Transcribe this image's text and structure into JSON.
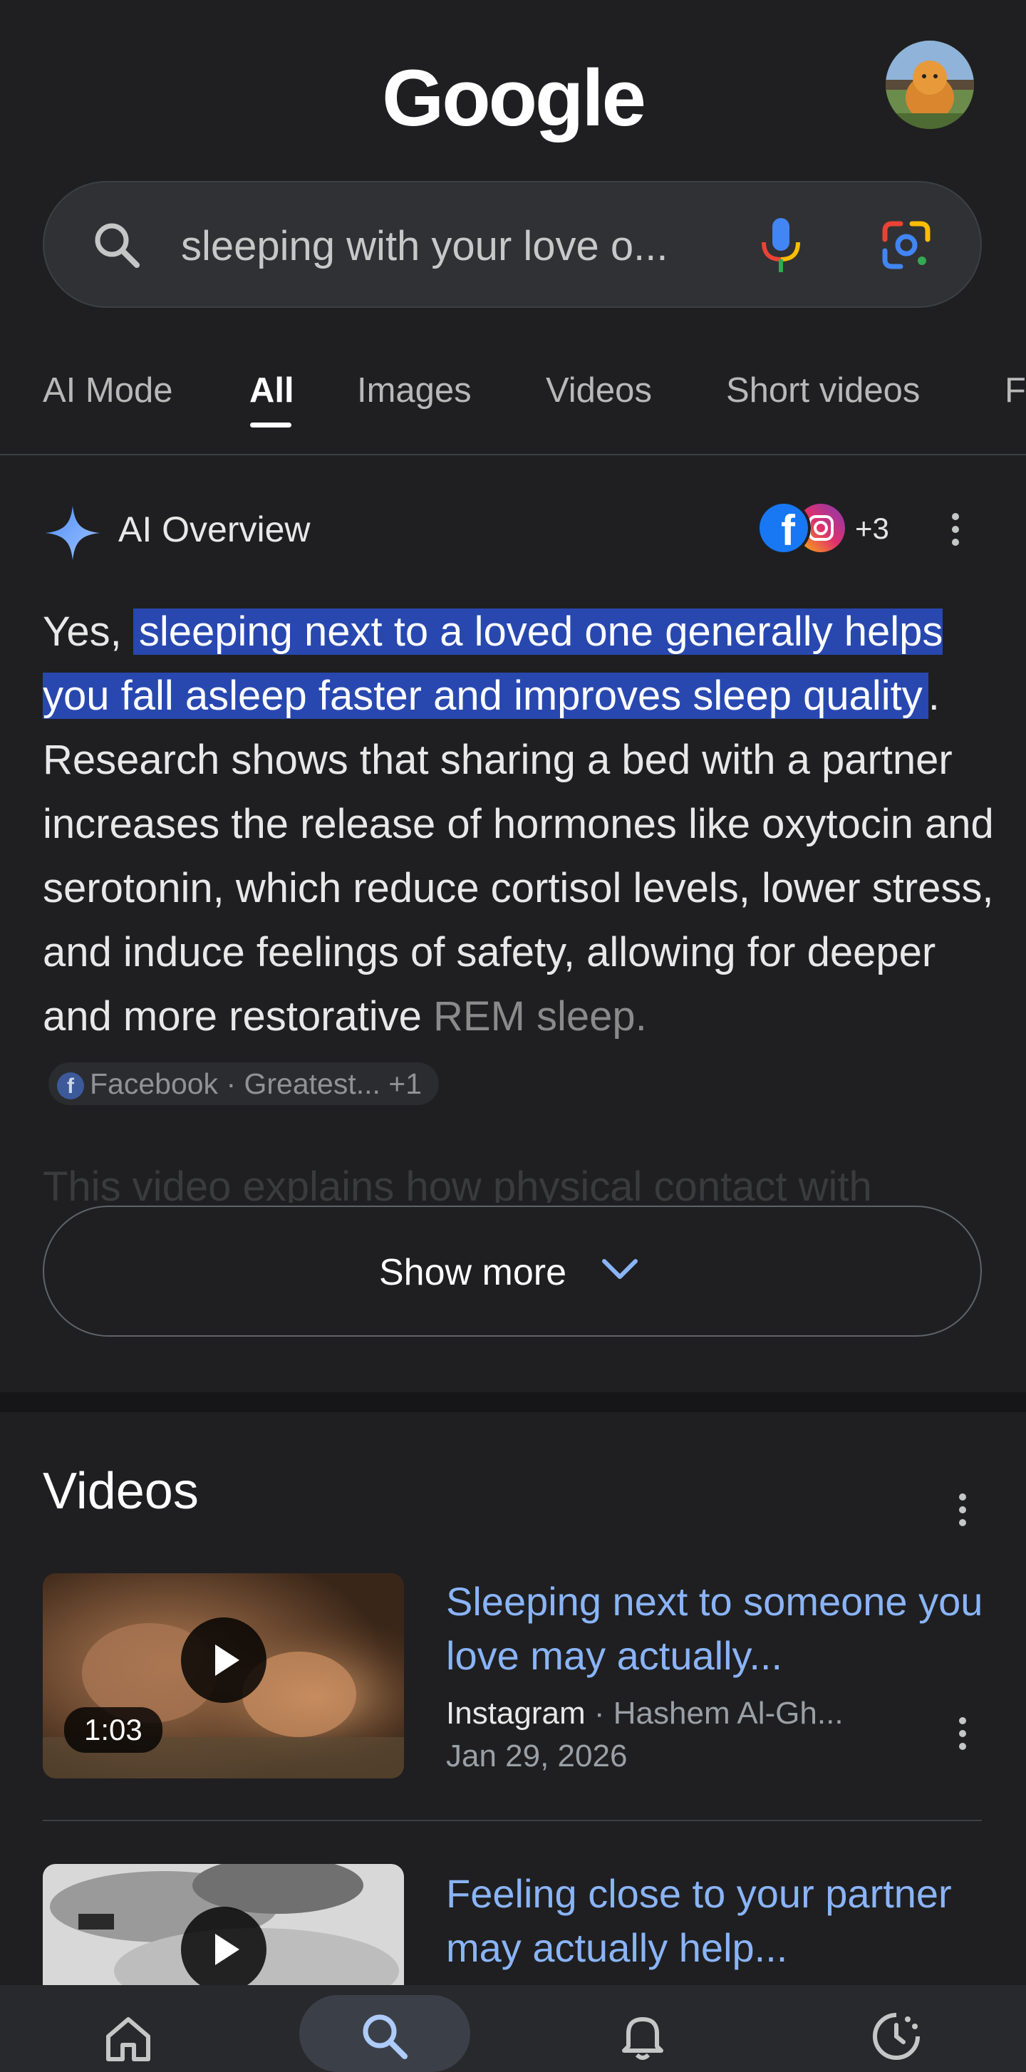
{
  "header": {
    "logo_text": "Google",
    "avatar_icon": "profile-avatar"
  },
  "search": {
    "query": "sleeping with your love o...",
    "icons": [
      "search-icon",
      "mic-icon",
      "lens-icon"
    ]
  },
  "tabs": [
    {
      "label": "AI Mode",
      "active": false
    },
    {
      "label": "All",
      "active": true
    },
    {
      "label": "Images",
      "active": false
    },
    {
      "label": "Videos",
      "active": false
    },
    {
      "label": "Short videos",
      "active": false
    },
    {
      "label": "F",
      "active": false
    }
  ],
  "ai_overview": {
    "title": "AI Overview",
    "source_count": "+3",
    "text_intro": "Yes, ",
    "text_highlight": "sleeping next to a loved one generally helps you fall asleep faster and improves sleep quality",
    "text_body": ". Research shows that sharing a bed with a partner increases the release of hormones like oxytocin and serotonin, which reduce cortisol levels, lower stress, and induce feelings of safety, allowing for deeper and more restorative ",
    "text_fade": "REM sleep.",
    "citation_chip": "Facebook · Greatest... +1",
    "truncated_line": "This video explains how physical contact with",
    "show_more_label": "Show more"
  },
  "videos": {
    "title": "Videos",
    "items": [
      {
        "title": "Sleeping next to someone you love may actually...",
        "source": "Instagram",
        "separator": "·",
        "author": "Hashem Al-Gh...",
        "date": "Jan 29, 2026",
        "duration": "1:03"
      },
      {
        "title": "Feeling close to your partner may actually help..."
      }
    ]
  },
  "bottom_nav": [
    "home-icon",
    "search-icon",
    "notifications-icon",
    "activity-icon"
  ],
  "colors": {
    "background": "#1f1f21",
    "link": "#8ab4f8",
    "highlight": "#2848b0"
  }
}
